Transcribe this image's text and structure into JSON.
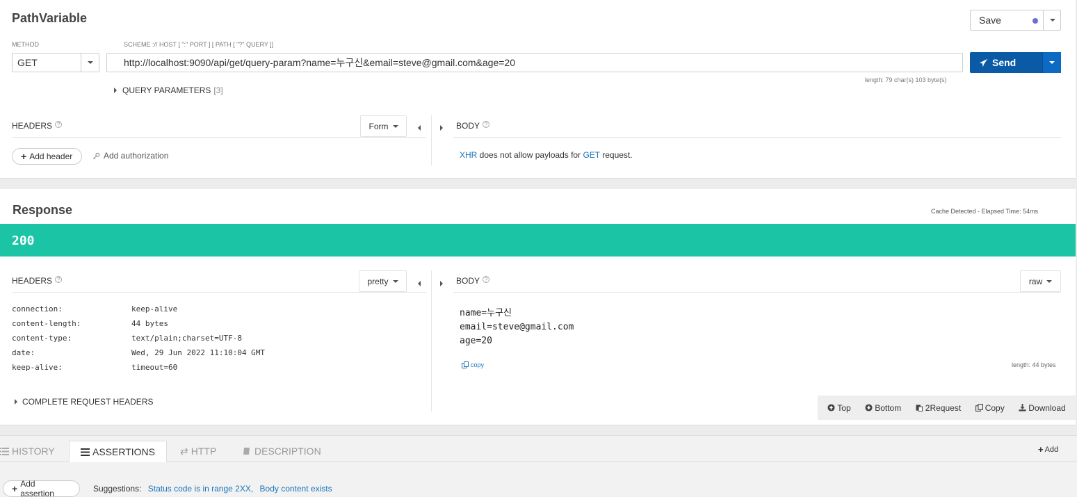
{
  "request": {
    "title": "PathVariable",
    "save_label": "Save",
    "method_label": "METHOD",
    "method_value": "GET",
    "url_hint": "SCHEME :// HOST [ \":\" PORT ] [ PATH [ \"?\" QUERY ]]",
    "url_value": "http://localhost:9090/api/get/query-param?name=누구신&email=steve@gmail.com&age=20",
    "send_label": "Send",
    "length_info": "length: 79 char(s) 103 byte(s)",
    "query_params_label": "QUERY PARAMETERS",
    "query_params_count": "[3]",
    "headers_label": "HEADERS",
    "headers_mode": "Form",
    "add_header_label": "Add header",
    "add_auth_label": "Add authorization",
    "body_label": "BODY",
    "body_msg_xhr": "XHR",
    "body_msg_mid": " does not allow payloads for ",
    "body_msg_get": "GET",
    "body_msg_end": " request."
  },
  "response": {
    "title": "Response",
    "cache_info": "Cache Detected - Elapsed Time: 54ms",
    "status_code": "200",
    "status_color": "#1ac4a5",
    "headers_label": "HEADERS",
    "headers_mode": "pretty",
    "headers": [
      {
        "key": "connection:",
        "value": "keep-alive"
      },
      {
        "key": "content-length:",
        "value": "44 bytes"
      },
      {
        "key": "content-type:",
        "value": "text/plain;charset=UTF-8"
      },
      {
        "key": "date:",
        "value": "Wed, 29 Jun 2022 11:10:04 GMT"
      },
      {
        "key": "keep-alive:",
        "value": "timeout=60"
      }
    ],
    "complete_headers_label": "COMPLETE REQUEST HEADERS",
    "body_label": "BODY",
    "body_mode": "raw",
    "body_lines": [
      "name=누구신",
      "email=steve@gmail.com",
      "age=20"
    ],
    "copy_label": "copy",
    "length_info": "length: 44 bytes",
    "toolbar": {
      "top": "Top",
      "bottom": "Bottom",
      "to_request": "2Request",
      "copy": "Copy",
      "download": "Download"
    }
  },
  "bottom": {
    "tabs": [
      "HISTORY",
      "ASSERTIONS",
      "HTTP",
      "DESCRIPTION"
    ],
    "active_tab": "ASSERTIONS",
    "add_label": "Add",
    "add_assertion_label": "Add assertion",
    "suggestions_label": "Suggestions:",
    "suggestion_1": "Status code is in range 2XX,",
    "suggestion_2": "Body content exists"
  },
  "colors": {
    "accent_blue": "#0b5aa6",
    "status_green": "#1ac4a5",
    "link_blue": "#1a74b8",
    "save_dot": "#6a6fd6"
  }
}
